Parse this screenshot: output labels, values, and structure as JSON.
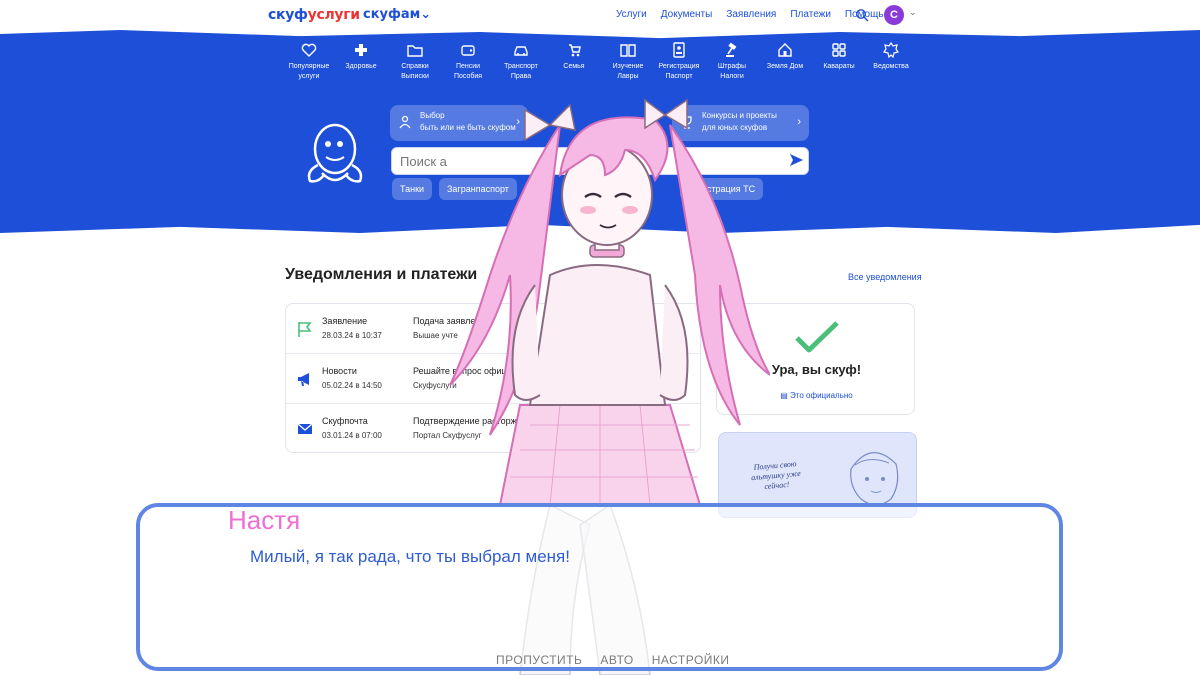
{
  "header": {
    "logo_main_a": "скуф",
    "logo_main_b": "услуги",
    "logo_secondary": "скуфам⌄",
    "nav": [
      "Услуги",
      "Документы",
      "Заявления",
      "Платежи",
      "Помощь"
    ],
    "avatar_letter": "С"
  },
  "categories": [
    {
      "label": "Популярные услуги",
      "icon": "heart-icon"
    },
    {
      "label": "Здоровье",
      "icon": "plus-icon"
    },
    {
      "label": "Справки Выписки",
      "icon": "folder-icon"
    },
    {
      "label": "Пенсии Пособия",
      "icon": "wallet-icon"
    },
    {
      "label": "Транспорт Права",
      "icon": "car-icon"
    },
    {
      "label": "Семья",
      "icon": "stroller-icon"
    },
    {
      "label": "Изучение Лавры",
      "icon": "book-icon"
    },
    {
      "label": "Регистрация Паспорт",
      "icon": "id-card-icon"
    },
    {
      "label": "Штрафы Налоги",
      "icon": "gavel-icon"
    },
    {
      "label": "Земля Дом",
      "icon": "house-icon"
    },
    {
      "label": "Кавараты",
      "icon": "grid-icon"
    },
    {
      "label": "Ведомства",
      "icon": "emblem-icon"
    }
  ],
  "promos": {
    "left_line1": "Выбор",
    "left_line2": "быть или не быть скуфом",
    "right_line1": "Конкурсы и проекты",
    "right_line2": "для юных скуфов"
  },
  "search": {
    "placeholder": "Поиск а"
  },
  "chips": [
    "Танки",
    "Загранпаспорт",
    "Регистрация ТС"
  ],
  "notifications": {
    "title": "Уведомления и платежи",
    "all_link": "Все уведомления",
    "items": [
      {
        "type": "Заявление",
        "date": "28.03.24 в 10:37",
        "title": "Подача заявлени",
        "sub": "Вышае учте",
        "icon": "flag-icon"
      },
      {
        "type": "Новости",
        "date": "05.02.24 в 14:50",
        "title": "Решайте вопрос официал",
        "sub": "Скуфуслуги",
        "icon": "megaphone-icon"
      },
      {
        "type": "Скуфпочта",
        "date": "03.01.24 в 07:00",
        "title": "Подтверждение расторж",
        "sub": "Портал Скуфуслуг",
        "icon": "mail-icon"
      }
    ]
  },
  "status_card": {
    "title": "Ура, вы скуф!",
    "subtitle": "Это официально"
  },
  "promo_card": {
    "text": "Получи свою альтушку уже сейчас!"
  },
  "dialogue": {
    "speaker": "Настя",
    "line": "Милый, я так рада, что ты выбрал меня!",
    "menu": [
      "ПРОПУСТИТЬ",
      "АВТО",
      "НАСТРОЙКИ"
    ]
  },
  "colors": {
    "brand_blue": "#1d4fd8",
    "brand_red": "#e33333",
    "speaker_pink": "#ee6fd2",
    "dialog_border": "#5f86e2",
    "success_green": "#4bbf7a"
  }
}
